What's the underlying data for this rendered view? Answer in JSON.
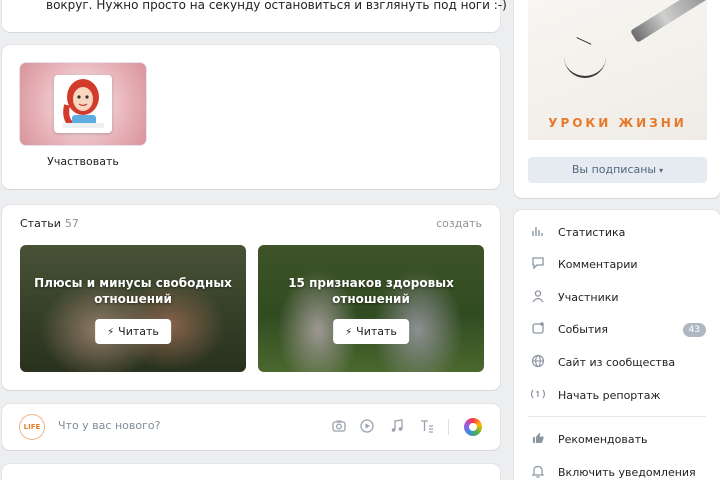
{
  "post_top": {
    "text": "вокруг. Нужно просто на секунду остановиться и взглянуть под ноги :-)"
  },
  "participate": {
    "label": "Участвовать"
  },
  "articles": {
    "title": "Статьи",
    "count": "57",
    "create_label": "создать",
    "items": [
      {
        "title": "Плюсы и минусы свободных отношений",
        "read_label": "Читать"
      },
      {
        "title": "15 признаков здоровых отношений",
        "read_label": "Читать"
      }
    ]
  },
  "composer": {
    "avatar_text": "LIFE",
    "placeholder": "Что у вас нового?",
    "icons": [
      "camera-icon",
      "video-icon",
      "music-icon",
      "text-format-icon",
      "color-picker-icon"
    ]
  },
  "cover": {
    "text": "УРОКИ ЖИЗНИ",
    "subscribed_label": "Вы подписаны"
  },
  "menu": {
    "items": [
      {
        "label": "Статистика",
        "icon": "stats-icon"
      },
      {
        "label": "Комментарии",
        "icon": "comments-icon"
      },
      {
        "label": "Участники",
        "icon": "members-icon"
      },
      {
        "label": "События",
        "icon": "events-icon",
        "badge": "43"
      },
      {
        "label": "Сайт из сообщества",
        "icon": "globe-icon"
      },
      {
        "label": "Начать репортаж",
        "icon": "broadcast-icon"
      },
      {
        "label": "Рекомендовать",
        "icon": "like-icon"
      },
      {
        "label": "Включить уведомления",
        "icon": "bell-icon"
      }
    ]
  },
  "colors": {
    "background": "#edeef0",
    "accent_orange": "#e8792b",
    "subscribe_bg": "#e5ebf1",
    "badge_bg": "#aeb7c2"
  }
}
